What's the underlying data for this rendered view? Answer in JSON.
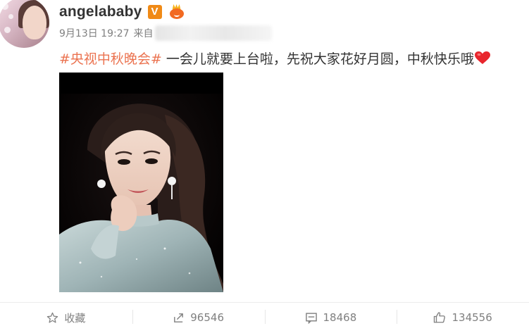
{
  "user": {
    "name": "angelababy",
    "verified_badge": "V"
  },
  "post": {
    "date": "9月13日 19:27",
    "source_prefix": "来自",
    "hashtag": "#央视中秋晚会#",
    "text": "一会儿就要上台啦，先祝大家花好月圆，中秋快乐哦",
    "emoji": "heart-emoji"
  },
  "actions": {
    "favorite_label": "收藏",
    "repost_count": "96546",
    "comment_count": "18468",
    "like_count": "134556"
  },
  "colors": {
    "hashtag": "#eb7350",
    "badge": "#f08a16",
    "heart": "#e8262d"
  }
}
